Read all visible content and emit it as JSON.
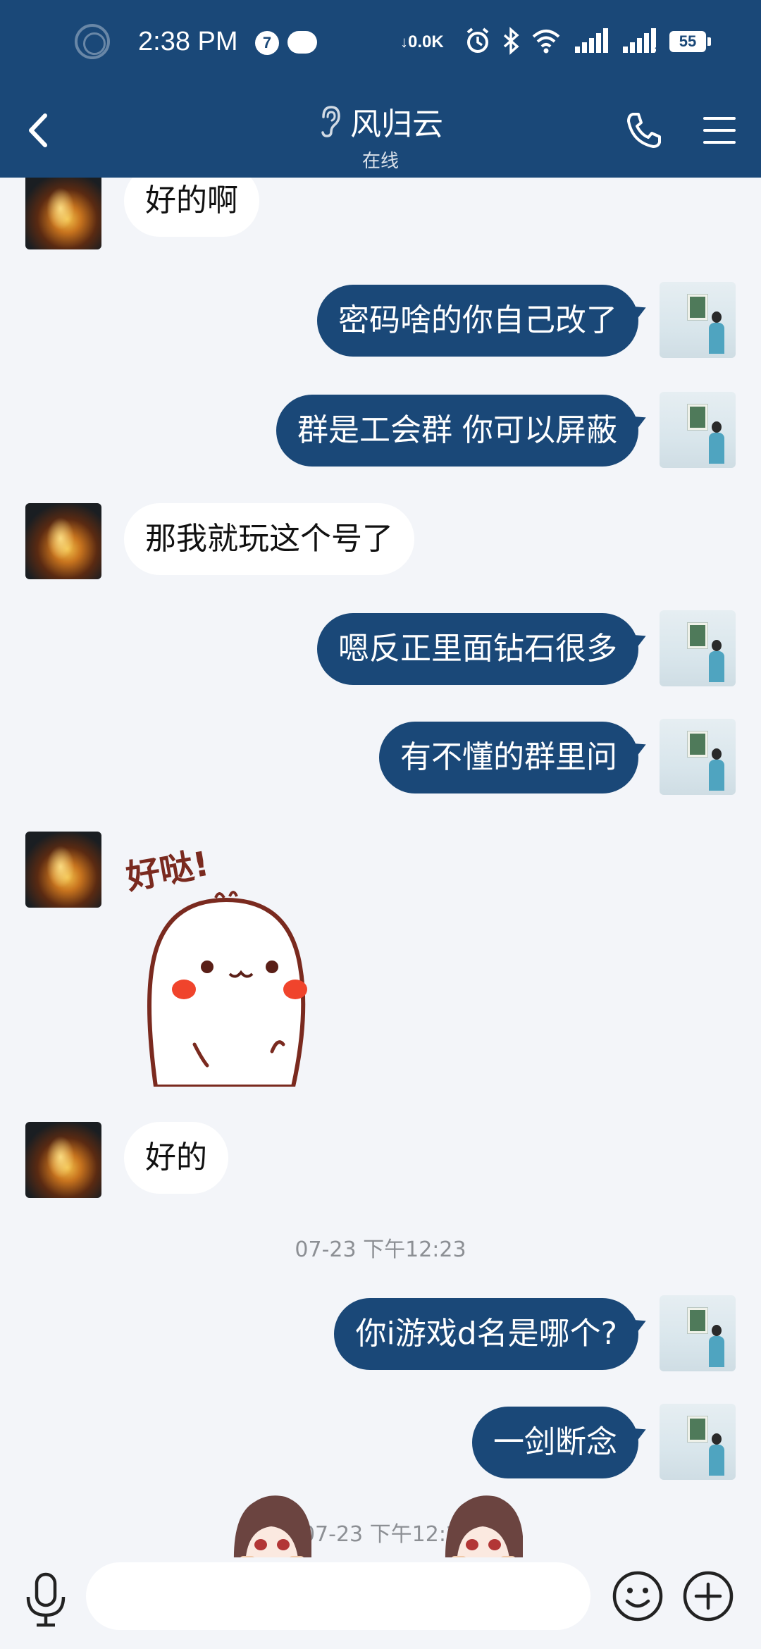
{
  "status_bar": {
    "time": "2:38 PM",
    "notification_badge": "7",
    "net_speed": "0.0K",
    "battery": "55"
  },
  "header": {
    "title": "风归云",
    "subtitle": "在线"
  },
  "messages": [
    {
      "side": "in",
      "text": "好的啊"
    },
    {
      "side": "out",
      "text": "密码啥的你自己改了"
    },
    {
      "side": "out",
      "text": "群是工会群 你可以屏蔽"
    },
    {
      "side": "in",
      "text": "那我就玩这个号了"
    },
    {
      "side": "out",
      "text": "嗯反正里面钻石很多"
    },
    {
      "side": "out",
      "text": "有不懂的群里问"
    },
    {
      "side": "in",
      "sticker": "好哒!"
    },
    {
      "side": "in",
      "text": "好的"
    },
    {
      "timestamp": "07-23 下午12:23"
    },
    {
      "side": "out",
      "text": "你i游戏d名是哪个?"
    },
    {
      "side": "out",
      "text": "一剑断念"
    },
    {
      "timestamp": "07-23 下午12:2"
    }
  ],
  "input": {
    "placeholder": ""
  },
  "colors": {
    "header_bg": "#1a4878",
    "outgoing_bubble": "#1a4878",
    "incoming_bubble": "#ffffff",
    "chat_bg": "#f3f5f9"
  },
  "icons": [
    "back-icon",
    "ear-icon",
    "phone-icon",
    "menu-icon",
    "mic-icon",
    "emoji-icon",
    "plus-icon"
  ]
}
